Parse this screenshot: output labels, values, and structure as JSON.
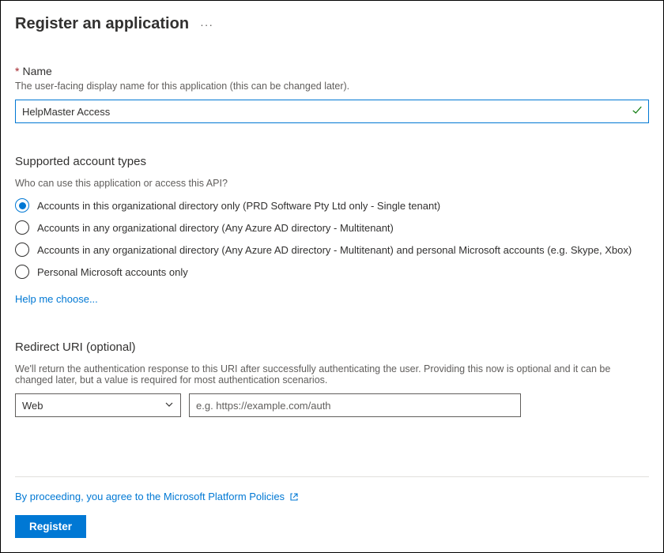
{
  "header": {
    "title": "Register an application"
  },
  "name_section": {
    "label": "Name",
    "help": "The user-facing display name for this application (this can be changed later).",
    "value": "HelpMaster Access"
  },
  "account_types": {
    "heading": "Supported account types",
    "help": "Who can use this application or access this API?",
    "options": [
      "Accounts in this organizational directory only (PRD Software Pty Ltd only - Single tenant)",
      "Accounts in any organizational directory (Any Azure AD directory - Multitenant)",
      "Accounts in any organizational directory (Any Azure AD directory - Multitenant) and personal Microsoft accounts (e.g. Skype, Xbox)",
      "Personal Microsoft accounts only"
    ],
    "selected_index": 0,
    "help_link": "Help me choose..."
  },
  "redirect": {
    "heading": "Redirect URI (optional)",
    "help": "We'll return the authentication response to this URI after successfully authenticating the user. Providing this now is optional and it can be changed later, but a value is required for most authentication scenarios.",
    "platform_selected": "Web",
    "uri_placeholder": "e.g. https://example.com/auth"
  },
  "footer": {
    "policy_text": "By proceeding, you agree to the Microsoft Platform Policies",
    "register_label": "Register"
  }
}
